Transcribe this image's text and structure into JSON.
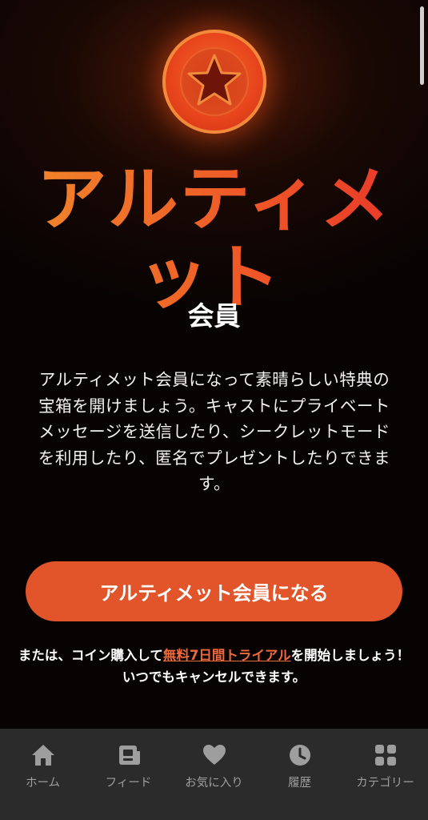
{
  "hero": {
    "title_line1": "アルティメ",
    "title_line2": "ット",
    "subtitle": "会員",
    "description": "アルティメット会員になって素晴らしい特典の宝箱を開けましょう。キャストにプライベートメッセージを送信したり、シークレットモードを利用したり、匿名でプレゼントしたりできます。"
  },
  "cta": {
    "label": "アルティメット会員になる"
  },
  "trial": {
    "prefix": "または、コイン購入して",
    "link": "無料7日間トライアル",
    "suffix": "を開始しましょう！",
    "note": "いつでもキャンセルできます。"
  },
  "tabbar": {
    "items": [
      {
        "label": "ホーム",
        "icon": "home-icon"
      },
      {
        "label": "フィード",
        "icon": "feed-icon"
      },
      {
        "label": "お気に入り",
        "icon": "heart-icon"
      },
      {
        "label": "履歴",
        "icon": "clock-icon"
      },
      {
        "label": "カテゴリー",
        "icon": "grid-icon"
      }
    ]
  },
  "colors": {
    "accent": "#e2552a",
    "link": "#ef6a3c",
    "tab_icon": "#9e9e9e",
    "tabbar_bg": "#2b2b2b"
  }
}
